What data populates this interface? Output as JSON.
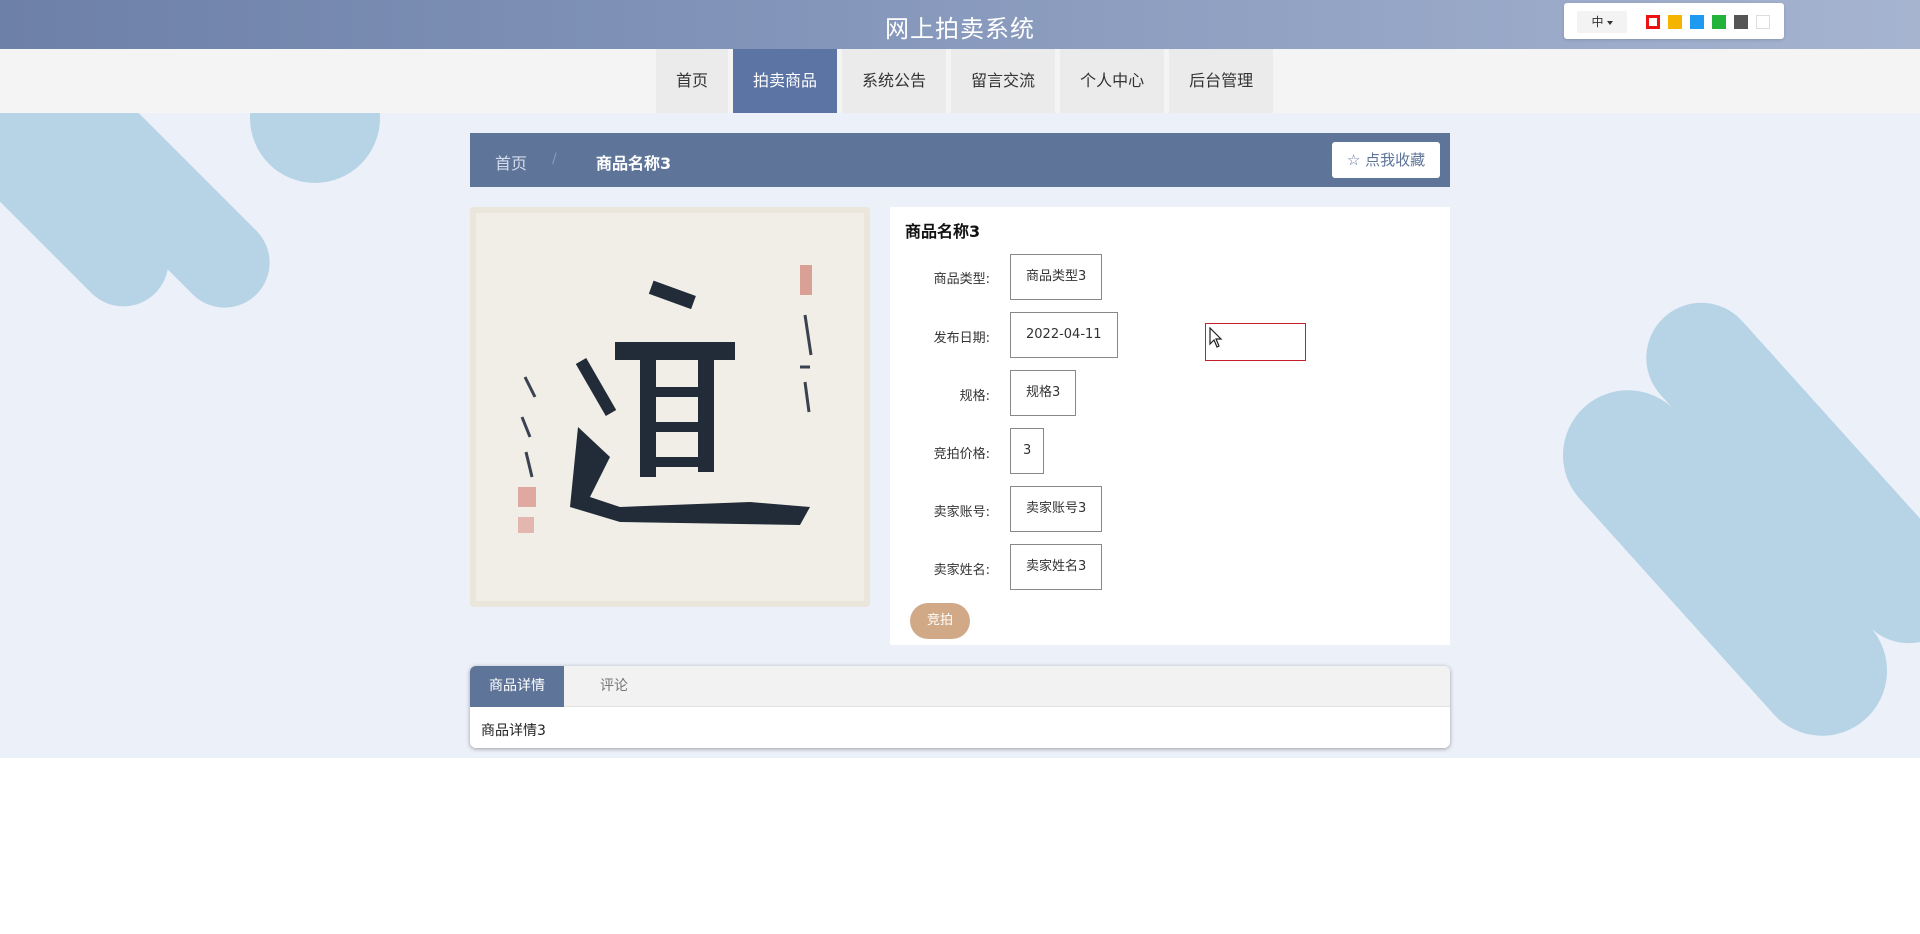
{
  "header": {
    "site_title": "网上拍卖系统",
    "language": "中",
    "theme_colors": [
      "#e11",
      "#f5b400",
      "#1e9bf0",
      "#21b33a",
      "#555555",
      "#ffffff"
    ]
  },
  "nav": {
    "items": [
      {
        "label": "首页"
      },
      {
        "label": "拍卖商品",
        "active": true
      },
      {
        "label": "系统公告"
      },
      {
        "label": "留言交流"
      },
      {
        "label": "个人中心"
      },
      {
        "label": "后台管理"
      }
    ]
  },
  "breadcrumb": {
    "home": "首页",
    "separator": "/",
    "current": "商品名称3",
    "favorite_label": "☆ 点我收藏"
  },
  "product": {
    "name": "商品名称3",
    "image_label": "道",
    "fields": [
      {
        "label": "商品类型:",
        "value": "商品类型3"
      },
      {
        "label": "发布日期:",
        "value": "2022-04-11"
      },
      {
        "label": "规格:",
        "value": "规格3"
      },
      {
        "label": "竞拍价格:",
        "value": "3"
      },
      {
        "label": "卖家账号:",
        "value": "卖家账号3"
      },
      {
        "label": "卖家姓名:",
        "value": "卖家姓名3"
      }
    ],
    "bid_label": "竞拍"
  },
  "tabs": {
    "items": [
      {
        "label": "商品详情",
        "active": true
      },
      {
        "label": "评论"
      }
    ],
    "content": "商品详情3"
  },
  "colors": {
    "primary": "#5e7499",
    "bid_button": "#d2a987",
    "page_band": "#ecf0f9"
  }
}
